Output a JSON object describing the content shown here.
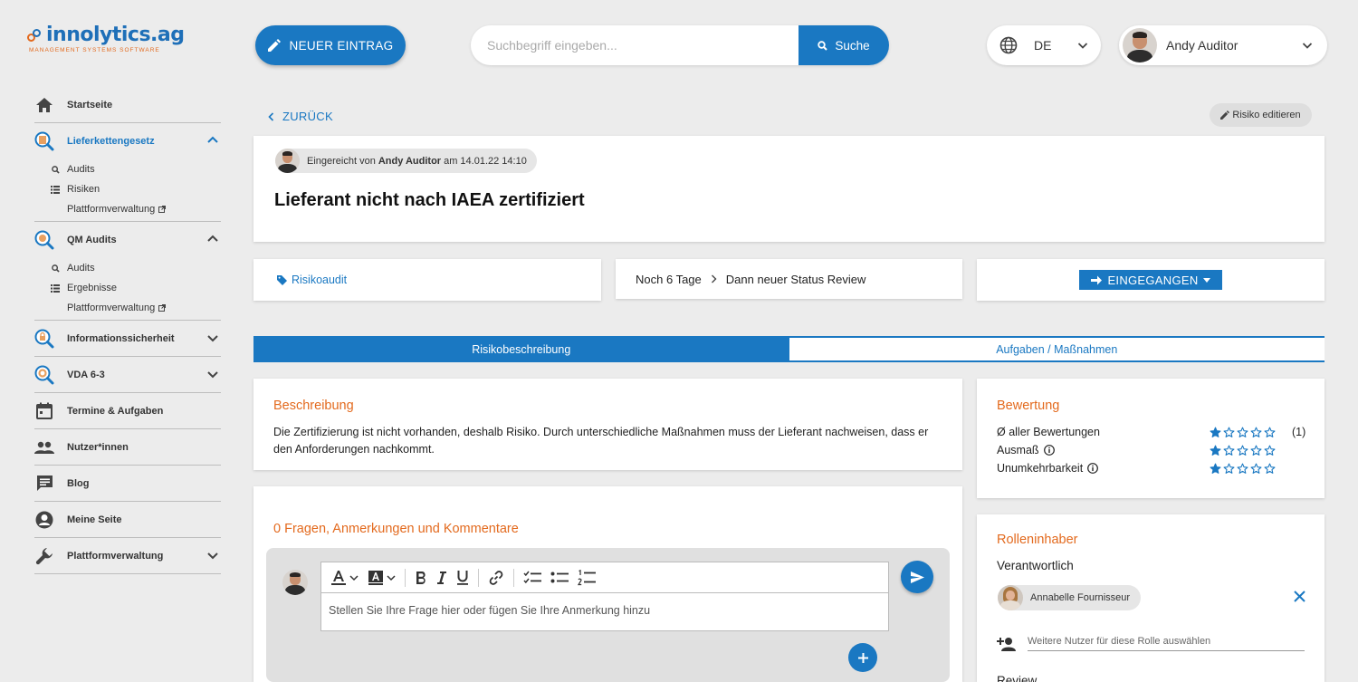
{
  "brand": {
    "name": "innolytics.ag",
    "tagline": "MANAGEMENT SYSTEMS SOFTWARE",
    "primary": "#1a78c2",
    "accent": "#e36a1e"
  },
  "sidebar": {
    "home": "Startseite",
    "group1": {
      "label": "Lieferkettengesetz",
      "items": [
        "Audits",
        "Risiken",
        "Plattformverwaltung"
      ]
    },
    "group2": {
      "label": "QM Audits",
      "items": [
        "Audits",
        "Ergebnisse",
        "Plattformverwaltung"
      ]
    },
    "infosec": "Informationssicherheit",
    "vda": "VDA 6-3",
    "termine": "Termine & Aufgaben",
    "nutzer": "Nutzer*innen",
    "blog": "Blog",
    "meine": "Meine Seite",
    "platform": "Plattformverwaltung"
  },
  "topbar": {
    "new_entry": "NEUER EINTRAG",
    "search_placeholder": "Suchbegriff eingeben...",
    "search_button": "Suche",
    "language": "DE",
    "user": "Andy Auditor"
  },
  "page": {
    "back": "ZURÜCK",
    "edit": "Risiko editieren",
    "submitted_prefix": "Eingereicht von",
    "submitted_user": "Andy Auditor",
    "submitted_suffix": "am 14.01.22 14:10",
    "title": "Lieferant nicht nach IAEA zertifiziert",
    "tag": "Risikoaudit",
    "deadline": "Noch 6 Tage",
    "next_status": "Dann neuer Status Review",
    "status": "EINGEGANGEN",
    "tabs": [
      "Risikobeschreibung",
      "Aufgaben / Maßnahmen"
    ],
    "active_tab": 0
  },
  "description": {
    "title": "Beschreibung",
    "text": "Die Zertifizierung ist nicht vorhanden, deshalb Risiko. Durch unterschiedliche Maßnahmen muss der Lieferant nachweisen, dass er den Anforderungen nachkommt."
  },
  "rating": {
    "title": "Bewertung",
    "rows": [
      {
        "label": "Ø aller Bewertungen",
        "stars": 1,
        "max": 5,
        "count": "(1)",
        "info": false
      },
      {
        "label": "Ausmaß",
        "stars": 1,
        "max": 5,
        "count": "",
        "info": true
      },
      {
        "label": "Unumkehrbarkeit",
        "stars": 1,
        "max": 5,
        "count": "",
        "info": true
      }
    ]
  },
  "comments": {
    "title": "0 Fragen, Anmerkungen und Kommentare",
    "placeholder": "Stellen Sie Ihre Frage hier oder fügen Sie Ihre Anmerkung hinzu"
  },
  "roles": {
    "title": "Rolleninhaber",
    "responsible_label": "Verantwortlich",
    "responsible_user": "Annabelle Fournisseur",
    "add_placeholder": "Weitere Nutzer für diese Rolle auswählen",
    "next_label": "Review"
  }
}
